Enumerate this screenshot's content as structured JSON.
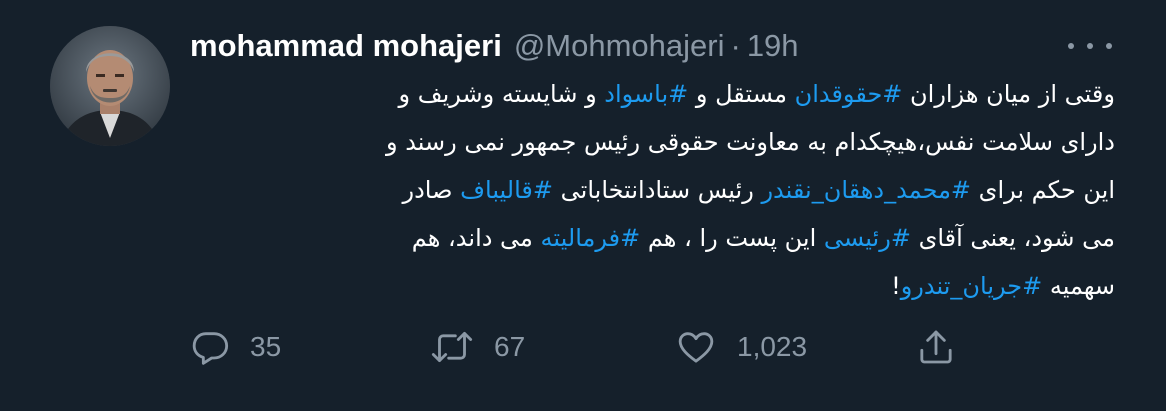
{
  "author": {
    "display_name": "mohammad mohajeri",
    "handle": "@Mohmohajeri",
    "separator": "·",
    "time": "19h"
  },
  "tweet": {
    "lines": [
      [
        {
          "text": "وقتی از میان هزاران ",
          "hashtag": false
        },
        {
          "text": "#حقوقدان",
          "hashtag": true
        },
        {
          "text": " مستقل و ",
          "hashtag": false
        },
        {
          "text": "#باسواد",
          "hashtag": true
        },
        {
          "text": " و شایسته وشریف و",
          "hashtag": false
        }
      ],
      [
        {
          "text": "دارای سلامت نفس،هیچکدام به معاونت حقوقی رئیس جمهور نمی رسند و",
          "hashtag": false
        }
      ],
      [
        {
          "text": "این حکم برای ",
          "hashtag": false
        },
        {
          "text": "#محمد_دهقان_نقندر",
          "hashtag": true
        },
        {
          "text": " رئیس ستادانتخاباتی ",
          "hashtag": false
        },
        {
          "text": "#قالیباف",
          "hashtag": true
        },
        {
          "text": " صادر",
          "hashtag": false
        }
      ],
      [
        {
          "text": "می شود، یعنی آقای ",
          "hashtag": false
        },
        {
          "text": "#رئیسی",
          "hashtag": true
        },
        {
          "text": " این پست را ، هم ",
          "hashtag": false
        },
        {
          "text": "#فرمالیته",
          "hashtag": true
        },
        {
          "text": " می داند، هم",
          "hashtag": false
        }
      ],
      [
        {
          "text": "سهمیه ",
          "hashtag": false
        },
        {
          "text": "#جریان_تندرو",
          "hashtag": true
        },
        {
          "text": "!",
          "hashtag": false
        }
      ]
    ]
  },
  "actions": {
    "reply_count": "35",
    "retweet_count": "67",
    "like_count": "1,023"
  },
  "icons": {
    "reply": "reply-icon",
    "retweet": "retweet-icon",
    "like": "like-icon",
    "share": "share-icon",
    "more": "more-icon"
  },
  "colors": {
    "background": "#15202b",
    "text": "#ffffff",
    "secondary": "#8b98a5",
    "hashtag": "#1d9bf0"
  }
}
